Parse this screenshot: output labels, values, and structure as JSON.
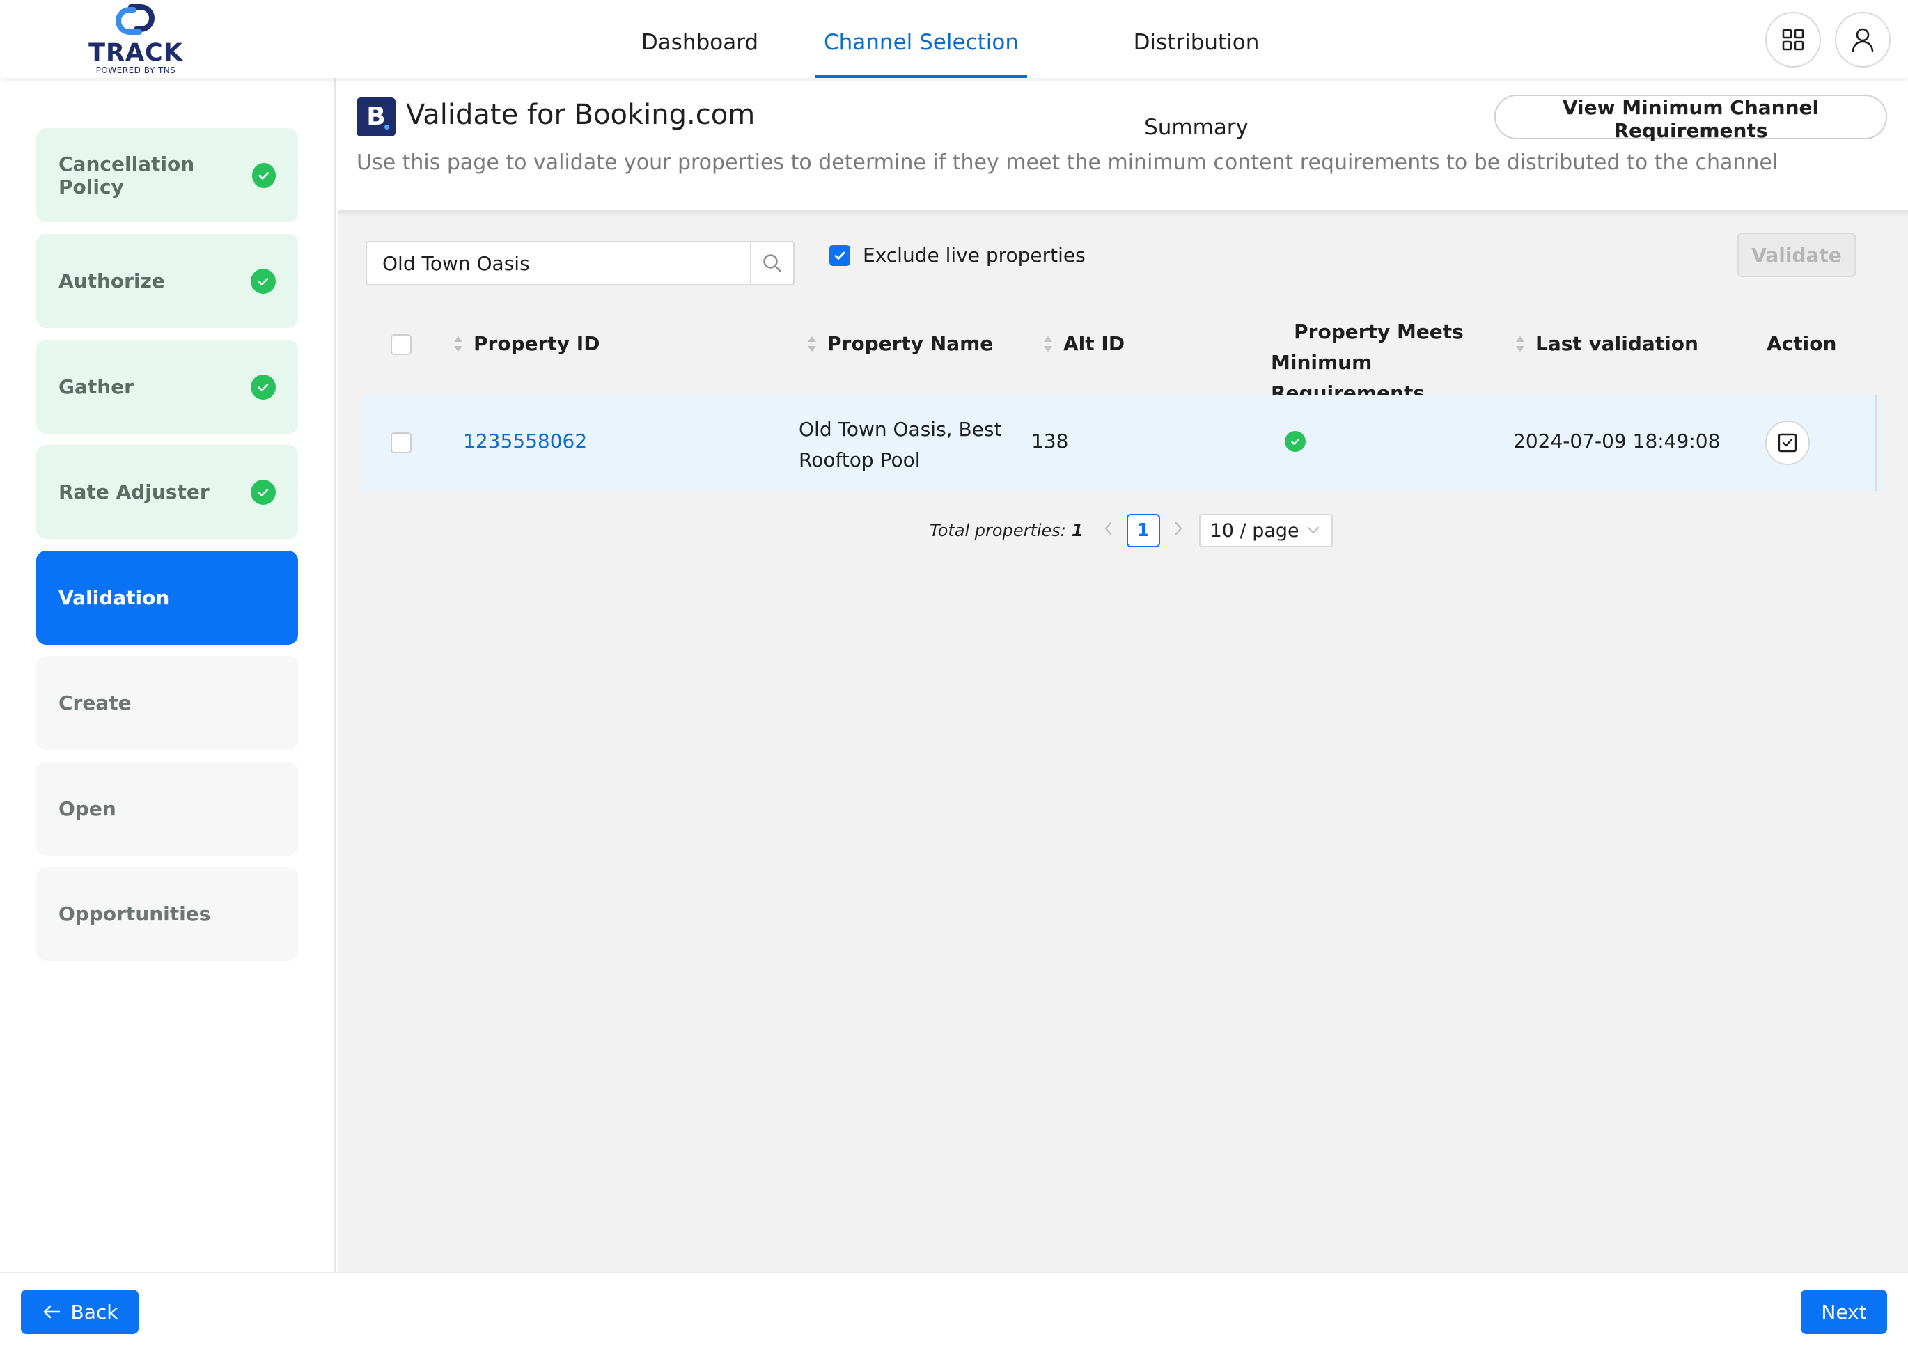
{
  "brand": {
    "name": "TRACK",
    "tagline": "POWERED BY TNS"
  },
  "nav": {
    "tabs": [
      {
        "label": "Dashboard"
      },
      {
        "label": "Channel Selection"
      },
      {
        "label": "Distribution Summary"
      }
    ],
    "active": "Channel Selection"
  },
  "steps": [
    {
      "label": "Cancellation Policy",
      "status": "done"
    },
    {
      "label": "Authorize",
      "status": "done"
    },
    {
      "label": "Gather",
      "status": "done"
    },
    {
      "label": "Rate Adjuster",
      "status": "done"
    },
    {
      "label": "Validation",
      "status": "active"
    },
    {
      "label": "Create",
      "status": "todo"
    },
    {
      "label": "Open",
      "status": "todo"
    },
    {
      "label": "Opportunities",
      "status": "todo"
    }
  ],
  "header": {
    "badge": "B",
    "title": "Validate for Booking.com",
    "description": "Use this page to validate your properties to determine if they meet the minimum content requirements to be distributed to the channel",
    "requirements_button": "View Minimum Channel Requirements"
  },
  "toolbar": {
    "search_value": "Old Town Oasis",
    "exclude_label": "Exclude live properties",
    "exclude_checked": true,
    "validate_label": "Validate"
  },
  "table": {
    "columns": {
      "property_id": "Property ID",
      "property_name": "Property Name",
      "alt_id": "Alt ID",
      "meets_line1": "Property Meets",
      "meets_line2": "Minimum Requirements",
      "last_validation": "Last validation",
      "action": "Action"
    },
    "rows": [
      {
        "property_id": "1235558062",
        "property_name_line1": "Old Town Oasis, Best",
        "property_name_line2": "Rooftop Pool",
        "alt_id": "138",
        "meets": true,
        "last_validation": "2024-07-09 18:49:08"
      }
    ]
  },
  "pagination": {
    "total_label": "Total properties:",
    "total": "1",
    "current_page": "1",
    "page_size": "10 / page"
  },
  "footer": {
    "back_label": "Back",
    "next_label": "Next"
  },
  "colors": {
    "accent": "#0a73f5",
    "link": "#0a6ed1",
    "success": "#27c25c",
    "done_bg": "#e6f8ee",
    "brand_navy": "#1d2c6b"
  }
}
